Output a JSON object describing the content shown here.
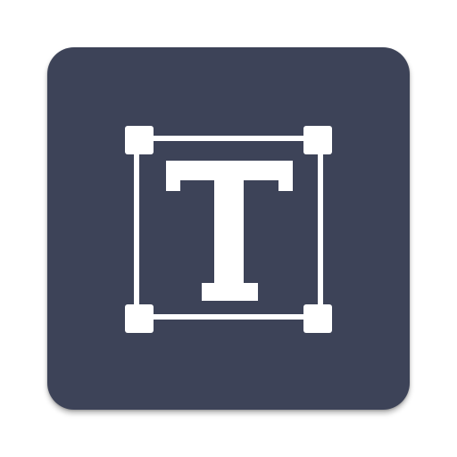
{
  "app_icon": {
    "icon": "text-frame-icon",
    "background_color": "#3d4358",
    "foreground_color": "#ffffff"
  }
}
